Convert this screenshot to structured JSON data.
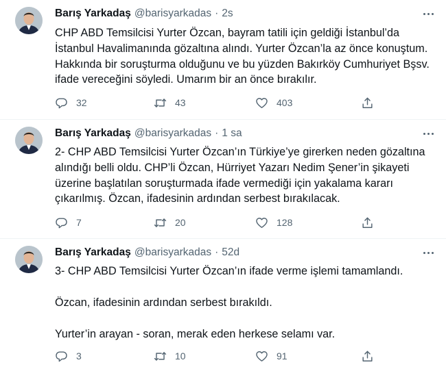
{
  "tweets": [
    {
      "name": "Barış Yarkadaş",
      "handle": "@barisyarkadas",
      "separator": "·",
      "time": "2s",
      "lines": [
        "CHP ABD Temsilcisi Yurter Özcan, bayram tatili için geldiği İstanbul’da",
        "İstanbul Havalimanında gözaltına alındı. Yurter Özcan’la az önce konuştum.",
        "Hakkında bir soruşturma olduğunu ve bu yüzden Bakırköy Cumhuriyet Bşsv.",
        "ifade vereceğini söyledi. Umarım bir an önce bırakılır."
      ],
      "replies": "32",
      "retweets": "43",
      "likes": "403"
    },
    {
      "name": "Barış Yarkadaş",
      "handle": "@barisyarkadas",
      "separator": "·",
      "time": "1 sa",
      "lines": [
        "2- CHP ABD Temsilcisi Yurter Özcan’ın Türkiye’ye girerken neden gözaltına",
        "alındığı belli oldu. CHP’li Özcan, Hürriyet Yazarı Nedim Şener’in şikayeti",
        "üzerine başlatılan soruşturmada ifade vermediği için yakalama kararı",
        "çıkarılmış. Özcan, ifadesinin ardından serbest bırakılacak."
      ],
      "replies": "7",
      "retweets": "20",
      "likes": "128"
    },
    {
      "name": "Barış Yarkadaş",
      "handle": "@barisyarkadas",
      "separator": "·",
      "time": "52d",
      "lines": [
        "3- CHP ABD Temsilcisi Yurter Özcan’ın ifade verme işlemi tamamlandı.",
        "",
        "Özcan, ifadesinin ardından serbest bırakıldı.",
        "",
        "Yurter’in arayan - soran, merak eden herkese selamı var."
      ],
      "replies": "3",
      "retweets": "10",
      "likes": "91"
    }
  ],
  "icons": {
    "reply": "reply-icon",
    "retweet": "retweet-icon",
    "like": "heart-icon",
    "share": "share-icon",
    "more": "more-icon"
  }
}
